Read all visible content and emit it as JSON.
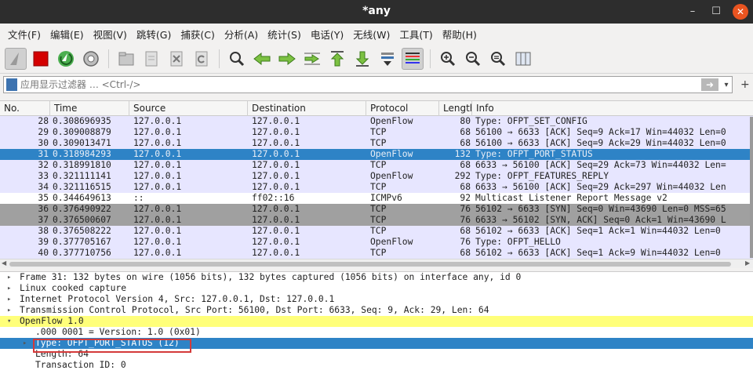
{
  "window": {
    "title": "*any",
    "min": "–",
    "max": "☐",
    "close": "✕"
  },
  "menu": [
    "文件(F)",
    "编辑(E)",
    "视图(V)",
    "跳转(G)",
    "捕获(C)",
    "分析(A)",
    "统计(S)",
    "电话(Y)",
    "无线(W)",
    "工具(T)",
    "帮助(H)"
  ],
  "filter": {
    "placeholder": "应用显示过滤器 … <Ctrl-/>",
    "apply": "➜",
    "dropdown": "▾",
    "extra": "+"
  },
  "columns": [
    "No.",
    "Time",
    "Source",
    "Destination",
    "Protocol",
    "Length",
    "Info"
  ],
  "packets": [
    {
      "no": "28",
      "time": "0.308696935",
      "src": "127.0.0.1",
      "dst": "127.0.0.1",
      "proto": "OpenFlow",
      "len": "80",
      "info": "Type: OFPT_SET_CONFIG",
      "style": "lav"
    },
    {
      "no": "29",
      "time": "0.309008879",
      "src": "127.0.0.1",
      "dst": "127.0.0.1",
      "proto": "TCP",
      "len": "68",
      "info": "56100 → 6633 [ACK] Seq=9 Ack=17 Win=44032 Len=0",
      "style": "lav"
    },
    {
      "no": "30",
      "time": "0.309013471",
      "src": "127.0.0.1",
      "dst": "127.0.0.1",
      "proto": "TCP",
      "len": "68",
      "info": "56100 → 6633 [ACK] Seq=9 Ack=29 Win=44032 Len=0",
      "style": "lav"
    },
    {
      "no": "31",
      "time": "0.318984293",
      "src": "127.0.0.1",
      "dst": "127.0.0.1",
      "proto": "OpenFlow",
      "len": "132",
      "info": "Type: OFPT_PORT_STATUS",
      "style": "sel"
    },
    {
      "no": "32",
      "time": "0.318991810",
      "src": "127.0.0.1",
      "dst": "127.0.0.1",
      "proto": "TCP",
      "len": "68",
      "info": "6633 → 56100 [ACK] Seq=29 Ack=73 Win=44032 Len=",
      "style": "lav"
    },
    {
      "no": "33",
      "time": "0.321111141",
      "src": "127.0.0.1",
      "dst": "127.0.0.1",
      "proto": "OpenFlow",
      "len": "292",
      "info": "Type: OFPT_FEATURES_REPLY",
      "style": "lav"
    },
    {
      "no": "34",
      "time": "0.321116515",
      "src": "127.0.0.1",
      "dst": "127.0.0.1",
      "proto": "TCP",
      "len": "68",
      "info": "6633 → 56100 [ACK] Seq=29 Ack=297 Win=44032 Len",
      "style": "lav"
    },
    {
      "no": "35",
      "time": "0.344649613",
      "src": "::",
      "dst": "ff02::16",
      "proto": "ICMPv6",
      "len": "92",
      "info": "Multicast Listener Report Message v2",
      "style": "white"
    },
    {
      "no": "36",
      "time": "0.376490922",
      "src": "127.0.0.1",
      "dst": "127.0.0.1",
      "proto": "TCP",
      "len": "76",
      "info": "56102 → 6633 [SYN] Seq=0 Win=43690 Len=0 MSS=65",
      "style": "gray"
    },
    {
      "no": "37",
      "time": "0.376500607",
      "src": "127.0.0.1",
      "dst": "127.0.0.1",
      "proto": "TCP",
      "len": "76",
      "info": "6633 → 56102 [SYN, ACK] Seq=0 Ack=1 Win=43690 L",
      "style": "gray"
    },
    {
      "no": "38",
      "time": "0.376508222",
      "src": "127.0.0.1",
      "dst": "127.0.0.1",
      "proto": "TCP",
      "len": "68",
      "info": "56102 → 6633 [ACK] Seq=1 Ack=1 Win=44032 Len=0",
      "style": "lav"
    },
    {
      "no": "39",
      "time": "0.377705167",
      "src": "127.0.0.1",
      "dst": "127.0.0.1",
      "proto": "OpenFlow",
      "len": "76",
      "info": "Type: OFPT_HELLO",
      "style": "lav"
    },
    {
      "no": "40",
      "time": "0.377710756",
      "src": "127.0.0.1",
      "dst": "127.0.0.1",
      "proto": "TCP",
      "len": "68",
      "info": "56102 → 6633 [ACK] Seq=1 Ack=9 Win=44032 Len=0",
      "style": "lav"
    }
  ],
  "details": [
    {
      "text": "Frame 31: 132 bytes on wire (1056 bits), 132 bytes captured (1056 bits) on interface any, id 0",
      "arrow": "▸",
      "indent": 0,
      "style": ""
    },
    {
      "text": "Linux cooked capture",
      "arrow": "▸",
      "indent": 0,
      "style": ""
    },
    {
      "text": "Internet Protocol Version 4, Src: 127.0.0.1, Dst: 127.0.0.1",
      "arrow": "▸",
      "indent": 0,
      "style": ""
    },
    {
      "text": "Transmission Control Protocol, Src Port: 56100, Dst Port: 6633, Seq: 9, Ack: 29, Len: 64",
      "arrow": "▸",
      "indent": 0,
      "style": ""
    },
    {
      "text": "OpenFlow 1.0",
      "arrow": "▾",
      "indent": 0,
      "style": "yellow"
    },
    {
      "text": ".000 0001 = Version: 1.0 (0x01)",
      "arrow": "",
      "indent": 2,
      "style": ""
    },
    {
      "text": "Type: OFPT_PORT_STATUS (12)",
      "arrow": "▸",
      "indent": 2,
      "style": "sel"
    },
    {
      "text": "Length: 64",
      "arrow": "",
      "indent": 2,
      "style": ""
    },
    {
      "text": "Transaction ID: 0",
      "arrow": "",
      "indent": 2,
      "style": ""
    }
  ],
  "colors": {
    "selected": "#2e83c6",
    "lavender": "#e7e6ff",
    "gray": "#a0a0a0",
    "highlight": "#ffff7a",
    "redbox": "#d43a3a"
  }
}
